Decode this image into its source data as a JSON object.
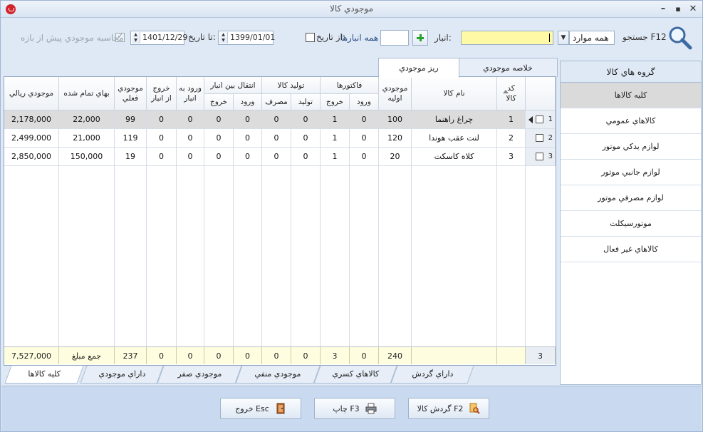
{
  "window": {
    "title": "موجودي كالا"
  },
  "toolbar": {
    "search_label": "جستجو F12",
    "filter_value": "همه موارد",
    "warehouse_label": "انبار:",
    "all_warehouses_label": "همه انبارها",
    "from_date_label": "از تاريخ:",
    "from_date_value": "1399/01/01",
    "to_date_label": "تا تاريخ:",
    "to_date_value": "1401/12/29",
    "calc_label": "محاسبه موجودي پيش از بازه"
  },
  "top_tabs": [
    "خلاصه موجودي",
    "ريز موجودي"
  ],
  "groups": {
    "header": "گروه هاي كالا",
    "items": [
      "كليه كالاها",
      "كالاهاي عمومي",
      "لوازم يدكي موتور",
      "لوازم جانبي موتور",
      "لوازم مصرفي موتور",
      "موتورسيكلت",
      "كالاهاي غير فعال"
    ]
  },
  "grid": {
    "headers": {
      "code": "كد كالا",
      "name": "نام كالا",
      "initial": "موجودي اوليه",
      "invoices": "فاكتورها",
      "inv_in": "ورود",
      "inv_out": "خروج",
      "production": "توليد كالا",
      "prod_make": "توليد",
      "prod_use": "مصرف",
      "transfer": "انتقال بين انبار",
      "tr_in": "ورود",
      "tr_out": "خروج",
      "wh_in": "ورود به انبار",
      "wh_out": "خروج از انبار",
      "current": "موجودي فعلي",
      "unit_cost": "بهاي تمام شده",
      "value": "موجودي ريالي"
    },
    "rows": [
      {
        "num": "1",
        "code": "1",
        "name": "چراغ راهنما",
        "initial": "100",
        "inv_in": "0",
        "inv_out": "1",
        "prod_make": "0",
        "prod_use": "0",
        "tr_in": "0",
        "tr_out": "0",
        "wh_in": "0",
        "wh_out": "0",
        "current": "99",
        "unit_cost": "22,000",
        "value": "2,178,000"
      },
      {
        "num": "2",
        "code": "2",
        "name": "لنت عقب هوندا",
        "initial": "120",
        "inv_in": "0",
        "inv_out": "1",
        "prod_make": "0",
        "prod_use": "0",
        "tr_in": "0",
        "tr_out": "0",
        "wh_in": "0",
        "wh_out": "0",
        "current": "119",
        "unit_cost": "21,000",
        "value": "2,499,000"
      },
      {
        "num": "3",
        "code": "3",
        "name": "كلاه كاسكت",
        "initial": "20",
        "inv_in": "0",
        "inv_out": "1",
        "prod_make": "0",
        "prod_use": "0",
        "tr_in": "0",
        "tr_out": "0",
        "wh_in": "0",
        "wh_out": "0",
        "current": "19",
        "unit_cost": "150,000",
        "value": "2,850,000"
      }
    ],
    "footer": {
      "count": "3",
      "initial": "240",
      "inv_in": "0",
      "inv_out": "3",
      "prod_make": "0",
      "prod_use": "0",
      "tr_in": "0",
      "tr_out": "0",
      "wh_in": "0",
      "wh_out": "0",
      "current": "237",
      "sum_label": "جمع مبلغ",
      "value": "7,527,000"
    }
  },
  "bottom_tabs": [
    "كليه كالاها",
    "داراي موجودي",
    "موجودي صفر",
    "موجودي منفي",
    "كالاهاي كسري",
    "داراي گردش"
  ],
  "buttons": {
    "turnover": "گردش كالا F2",
    "print": "چاپ F3",
    "exit": "خروج Esc"
  },
  "colors": {
    "search_highlight": "#fff9a6",
    "footer_bg": "#fffde0",
    "accent_red": "#d2232a",
    "plus_green": "#2aa12e"
  }
}
